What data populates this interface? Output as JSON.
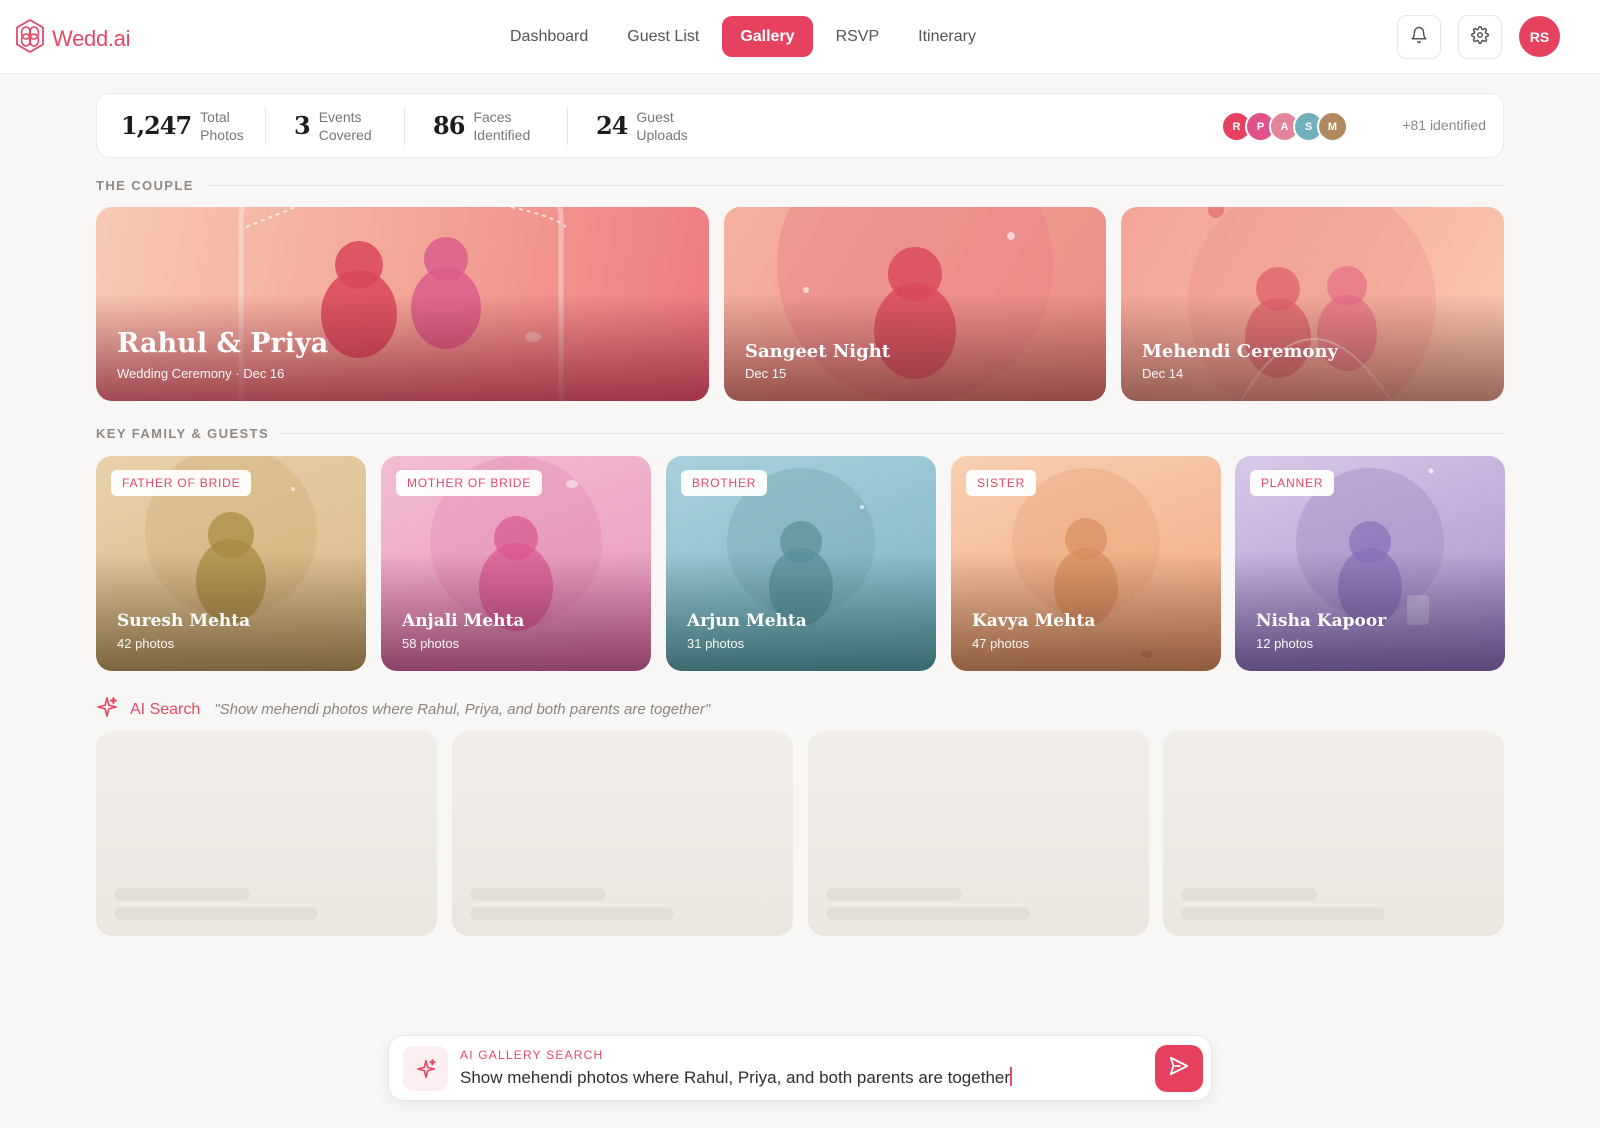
{
  "app": {
    "name": "Wedd.ai",
    "user_initials": "RS"
  },
  "nav": {
    "items": [
      "Dashboard",
      "Guest List",
      "Gallery",
      "RSVP",
      "Itinerary"
    ],
    "active": "Gallery"
  },
  "stats": [
    {
      "value": "1,247",
      "label1": "Total",
      "label2": "Photos"
    },
    {
      "value": "3",
      "label1": "Events",
      "label2": "Covered"
    },
    {
      "value": "86",
      "label1": "Faces",
      "label2": "Identified"
    },
    {
      "value": "24",
      "label1": "Guest",
      "label2": "Uploads"
    }
  ],
  "faces": {
    "avatars": [
      {
        "initial": "R",
        "color": "#e6415f"
      },
      {
        "initial": "P",
        "color": "#e0508a"
      },
      {
        "initial": "A",
        "color": "#e3849a"
      },
      {
        "initial": "S",
        "color": "#6fb0ba"
      },
      {
        "initial": "M",
        "color": "#b08a5e"
      }
    ],
    "more": "+81 identified"
  },
  "couple": {
    "heading": "THE COUPLE",
    "cards": [
      {
        "title": "Rahul & Priya",
        "subtitle": "Wedding Ceremony · Dec 16"
      },
      {
        "title": "Sangeet Night",
        "subtitle": "Dec 15"
      },
      {
        "title": "Mehendi Ceremony",
        "subtitle": "Dec 14"
      }
    ]
  },
  "family": {
    "heading": "KEY FAMILY & GUESTS",
    "cards": [
      {
        "badge": "FATHER OF BRIDE",
        "name": "Suresh Mehta",
        "count": "42 photos"
      },
      {
        "badge": "MOTHER OF BRIDE",
        "name": "Anjali Mehta",
        "count": "58 photos"
      },
      {
        "badge": "BROTHER",
        "name": "Arjun Mehta",
        "count": "31 photos"
      },
      {
        "badge": "SISTER",
        "name": "Kavya Mehta",
        "count": "47 photos"
      },
      {
        "badge": "PLANNER",
        "name": "Nisha Kapoor",
        "count": "12 photos"
      }
    ]
  },
  "ai_search": {
    "label": "AI Search",
    "query": "\"Show mehendi photos where Rahul, Priya, and both parents are together\""
  },
  "search_bar": {
    "label": "AI GALLERY SEARCH",
    "value": "Show mehendi photos where Rahul, Priya, and both parents are together"
  },
  "icons": {
    "logo": "logo-icon",
    "notifications": "bell-icon",
    "settings": "gear-icon",
    "ai": "sparkle-icon",
    "send": "send-icon"
  },
  "colors": {
    "accent": "#e6415f"
  }
}
